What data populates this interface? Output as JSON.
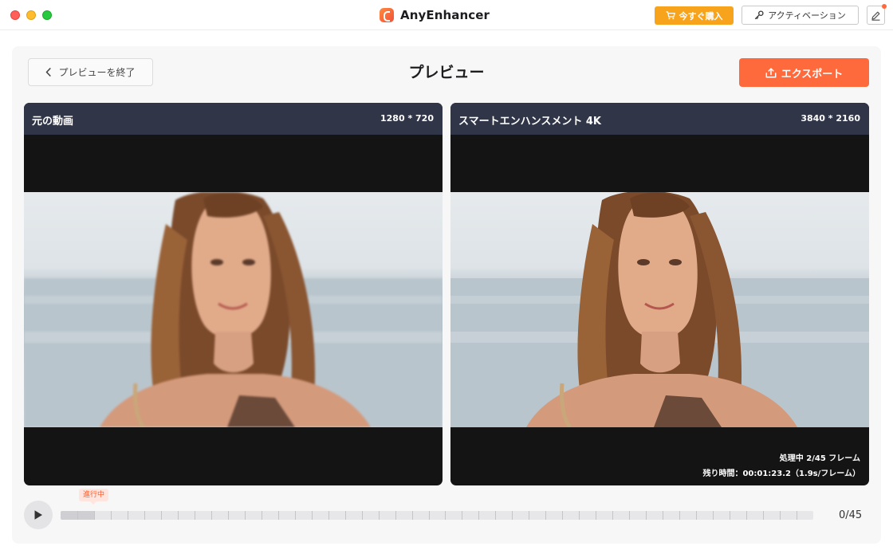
{
  "app": {
    "name": "AnyEnhancer"
  },
  "titlebar": {
    "buy_label": "今すぐ購入",
    "activate_label": "アクティベーション",
    "buy_icon": "cart-icon",
    "activate_icon": "key-icon",
    "feedback_icon": "pen-icon"
  },
  "toolbar": {
    "back_label": "プレビューを終了",
    "title": "プレビュー",
    "export_label": "エクスポート"
  },
  "original": {
    "title": "元の動画",
    "resolution": "1280 * 720"
  },
  "enhanced": {
    "title": "スマートエンハンスメント 4K",
    "resolution": "3840 * 2160",
    "status_processing": "処理中 2/45 フレーム",
    "status_remaining": "残り時間：00:01:23.2（1.9s/フレーム）"
  },
  "timeline": {
    "progress_tag": "進行中",
    "counter": "0/45",
    "processed_fraction": 0.045,
    "segments": 45
  },
  "colors": {
    "accent": "#ff6a3d",
    "buy": "#f7a41c",
    "pane_header": "#313548"
  }
}
